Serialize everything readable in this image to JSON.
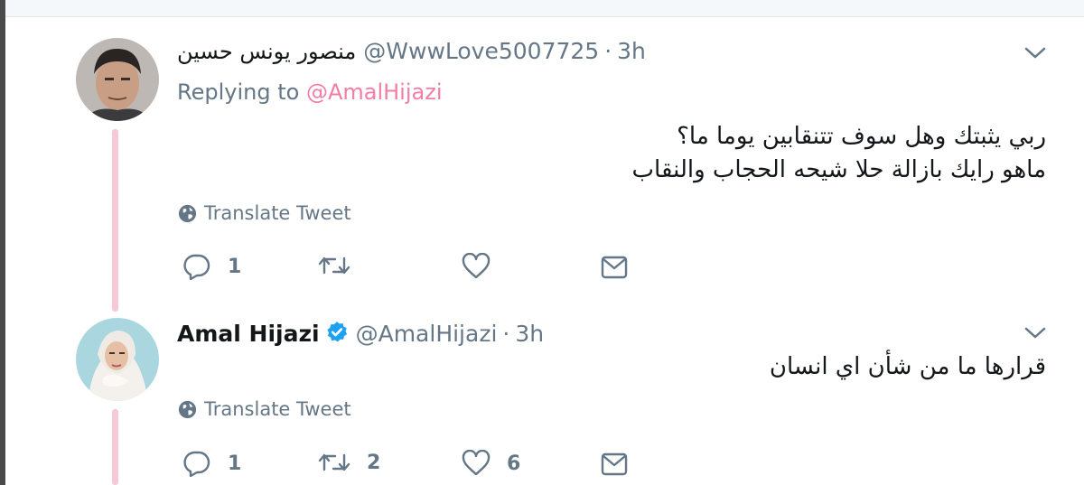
{
  "tweets": [
    {
      "display_name": "منصور يونس حسين",
      "handle": "@WwwLove5007725",
      "separator": "·",
      "time": "3h",
      "replying_prefix": "Replying to",
      "replying_to": "@AmalHijazi",
      "text_lines": [
        "ربي يثبتك  وهل سوف تتنقابين يوما ما؟",
        "ماهو رايك بازالة حلا شيحه الحجاب والنقاب"
      ],
      "translate_label": "Translate Tweet",
      "actions": {
        "reply_count": "1",
        "retweet_count": "",
        "like_count": ""
      }
    },
    {
      "display_name": "Amal Hijazi",
      "verified": true,
      "handle": "@AmalHijazi",
      "separator": "·",
      "time": "3h",
      "text_lines": [
        "قرارها ما من شأن اي انسان"
      ],
      "translate_label": "Translate Tweet",
      "actions": {
        "reply_count": "1",
        "retweet_count": "2",
        "like_count": "6"
      }
    }
  ],
  "colors": {
    "accent_mention": "#f37ea4",
    "thread_line": "#f6c9d6",
    "muted_text": "#657786",
    "verified_badge": "#1da1f2"
  },
  "icons": [
    "caret-down-icon",
    "verified-badge-icon",
    "globe-icon",
    "reply-icon",
    "retweet-icon",
    "like-icon",
    "direct-message-icon"
  ]
}
